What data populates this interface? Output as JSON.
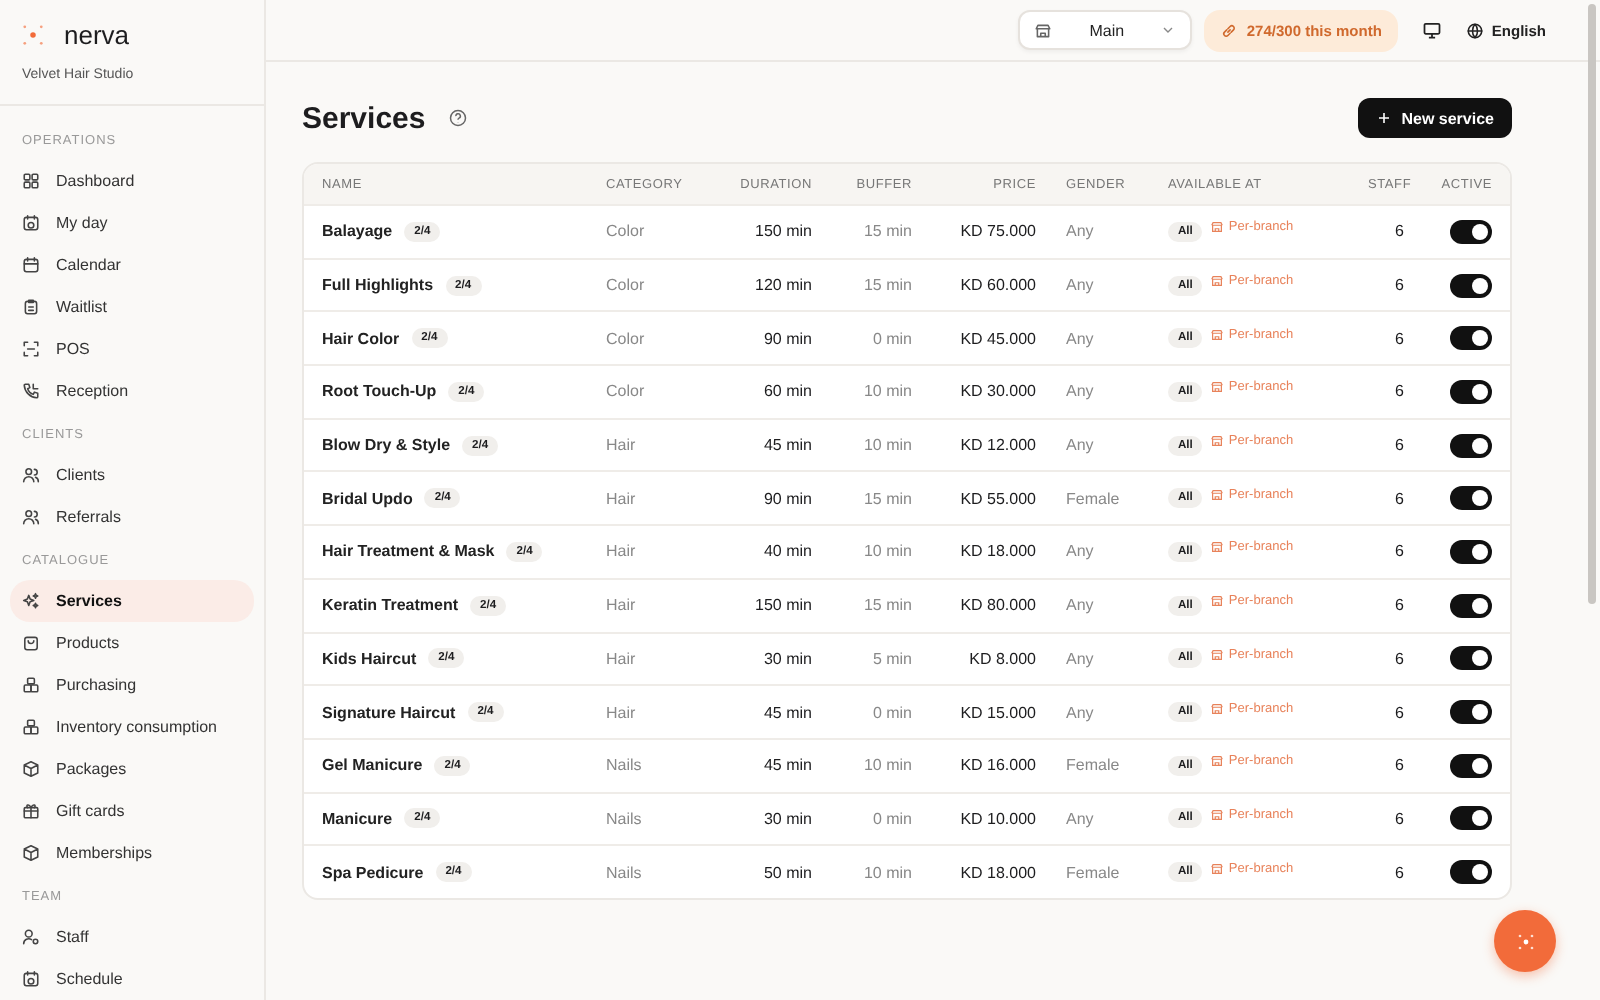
{
  "brand": {
    "name": "nerva",
    "workspace": "Velvet Hair Studio"
  },
  "sidebar": {
    "sections": [
      {
        "title": "OPERATIONS",
        "items": [
          {
            "label": "Dashboard",
            "selected": false
          },
          {
            "label": "My day",
            "selected": false
          },
          {
            "label": "Calendar",
            "selected": false
          },
          {
            "label": "Waitlist",
            "selected": false
          },
          {
            "label": "POS",
            "selected": false
          },
          {
            "label": "Reception",
            "selected": false
          }
        ]
      },
      {
        "title": "CLIENTS",
        "items": [
          {
            "label": "Clients",
            "selected": false
          },
          {
            "label": "Referrals",
            "selected": false
          }
        ]
      },
      {
        "title": "CATALOGUE",
        "items": [
          {
            "label": "Services",
            "selected": true
          },
          {
            "label": "Products",
            "selected": false
          },
          {
            "label": "Purchasing",
            "selected": false
          },
          {
            "label": "Inventory consumption",
            "selected": false
          },
          {
            "label": "Packages",
            "selected": false
          },
          {
            "label": "Gift cards",
            "selected": false
          },
          {
            "label": "Memberships",
            "selected": false
          }
        ]
      },
      {
        "title": "TEAM",
        "items": [
          {
            "label": "Staff",
            "selected": false
          },
          {
            "label": "Schedule",
            "selected": false
          }
        ]
      }
    ]
  },
  "topbar": {
    "branch": "Main",
    "usage": "274/300 this month",
    "language": "English"
  },
  "page": {
    "title": "Services",
    "new_button": "New service"
  },
  "table": {
    "columns": [
      "NAME",
      "CATEGORY",
      "DURATION",
      "BUFFER",
      "PRICE",
      "GENDER",
      "AVAILABLE AT",
      "STAFF",
      "ACTIVE"
    ],
    "rows": [
      {
        "name": "Balayage",
        "badge": "2/4",
        "category": "Color",
        "duration": "150 min",
        "buffer": "15 min",
        "price": "KD 75.000",
        "gender": "Any",
        "scope": "All",
        "availability": "Per-branch",
        "staff": "6",
        "active": true
      },
      {
        "name": "Full Highlights",
        "badge": "2/4",
        "category": "Color",
        "duration": "120 min",
        "buffer": "15 min",
        "price": "KD 60.000",
        "gender": "Any",
        "scope": "All",
        "availability": "Per-branch",
        "staff": "6",
        "active": true
      },
      {
        "name": "Hair Color",
        "badge": "2/4",
        "category": "Color",
        "duration": "90 min",
        "buffer": "0 min",
        "price": "KD 45.000",
        "gender": "Any",
        "scope": "All",
        "availability": "Per-branch",
        "staff": "6",
        "active": true
      },
      {
        "name": "Root Touch-Up",
        "badge": "2/4",
        "category": "Color",
        "duration": "60 min",
        "buffer": "10 min",
        "price": "KD 30.000",
        "gender": "Any",
        "scope": "All",
        "availability": "Per-branch",
        "staff": "6",
        "active": true
      },
      {
        "name": "Blow Dry & Style",
        "badge": "2/4",
        "category": "Hair",
        "duration": "45 min",
        "buffer": "10 min",
        "price": "KD 12.000",
        "gender": "Any",
        "scope": "All",
        "availability": "Per-branch",
        "staff": "6",
        "active": true
      },
      {
        "name": "Bridal Updo",
        "badge": "2/4",
        "category": "Hair",
        "duration": "90 min",
        "buffer": "15 min",
        "price": "KD 55.000",
        "gender": "Female",
        "scope": "All",
        "availability": "Per-branch",
        "staff": "6",
        "active": true
      },
      {
        "name": "Hair Treatment & Mask",
        "badge": "2/4",
        "category": "Hair",
        "duration": "40 min",
        "buffer": "10 min",
        "price": "KD 18.000",
        "gender": "Any",
        "scope": "All",
        "availability": "Per-branch",
        "staff": "6",
        "active": true
      },
      {
        "name": "Keratin Treatment",
        "badge": "2/4",
        "category": "Hair",
        "duration": "150 min",
        "buffer": "15 min",
        "price": "KD 80.000",
        "gender": "Any",
        "scope": "All",
        "availability": "Per-branch",
        "staff": "6",
        "active": true
      },
      {
        "name": "Kids Haircut",
        "badge": "2/4",
        "category": "Hair",
        "duration": "30 min",
        "buffer": "5 min",
        "price": "KD 8.000",
        "gender": "Any",
        "scope": "All",
        "availability": "Per-branch",
        "staff": "6",
        "active": true
      },
      {
        "name": "Signature Haircut",
        "badge": "2/4",
        "category": "Hair",
        "duration": "45 min",
        "buffer": "0 min",
        "price": "KD 15.000",
        "gender": "Any",
        "scope": "All",
        "availability": "Per-branch",
        "staff": "6",
        "active": true
      },
      {
        "name": "Gel Manicure",
        "badge": "2/4",
        "category": "Nails",
        "duration": "45 min",
        "buffer": "10 min",
        "price": "KD 16.000",
        "gender": "Female",
        "scope": "All",
        "availability": "Per-branch",
        "staff": "6",
        "active": true
      },
      {
        "name": "Manicure",
        "badge": "2/4",
        "category": "Nails",
        "duration": "30 min",
        "buffer": "0 min",
        "price": "KD 10.000",
        "gender": "Any",
        "scope": "All",
        "availability": "Per-branch",
        "staff": "6",
        "active": true
      },
      {
        "name": "Spa Pedicure",
        "badge": "2/4",
        "category": "Nails",
        "duration": "50 min",
        "buffer": "10 min",
        "price": "KD 18.000",
        "gender": "Female",
        "scope": "All",
        "availability": "Per-branch",
        "staff": "6",
        "active": true
      }
    ]
  }
}
